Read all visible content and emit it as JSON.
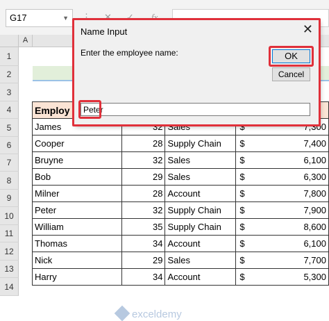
{
  "formula_bar": {
    "name_box": "G17",
    "fx_label": "fx"
  },
  "sheet": {
    "columns": [
      "A"
    ],
    "rows": [
      "1",
      "2",
      "3",
      "4",
      "5",
      "6",
      "7",
      "8",
      "9",
      "10",
      "11",
      "12",
      "13",
      "14"
    ],
    "header": {
      "name": "Employ"
    },
    "data": [
      {
        "name": "James",
        "age": "32",
        "dept": "Sales",
        "currency": "$",
        "salary": "7,300"
      },
      {
        "name": "Cooper",
        "age": "28",
        "dept": "Supply Chain",
        "currency": "$",
        "salary": "7,400"
      },
      {
        "name": "Bruyne",
        "age": "32",
        "dept": "Sales",
        "currency": "$",
        "salary": "6,100"
      },
      {
        "name": "Bob",
        "age": "29",
        "dept": "Sales",
        "currency": "$",
        "salary": "6,300"
      },
      {
        "name": "Milner",
        "age": "28",
        "dept": "Account",
        "currency": "$",
        "salary": "7,800"
      },
      {
        "name": "Peter",
        "age": "32",
        "dept": "Supply Chain",
        "currency": "$",
        "salary": "7,900"
      },
      {
        "name": "William",
        "age": "35",
        "dept": "Supply Chain",
        "currency": "$",
        "salary": "8,600"
      },
      {
        "name": "Thomas",
        "age": "34",
        "dept": "Account",
        "currency": "$",
        "salary": "6,100"
      },
      {
        "name": "Nick",
        "age": "29",
        "dept": "Sales",
        "currency": "$",
        "salary": "7,700"
      },
      {
        "name": "Harry",
        "age": "34",
        "dept": "Account",
        "currency": "$",
        "salary": "5,300"
      }
    ],
    "watermark": "exceldemy"
  },
  "dialog": {
    "title": "Name Input",
    "close_glyph": "✕",
    "prompt": "Enter the employee name:",
    "ok_label": "OK",
    "cancel_label": "Cancel",
    "input_value": "Peter"
  },
  "colors": {
    "highlight": "#e0303a",
    "header_fill": "#fbe4d5",
    "title_band": "#e2efda"
  }
}
